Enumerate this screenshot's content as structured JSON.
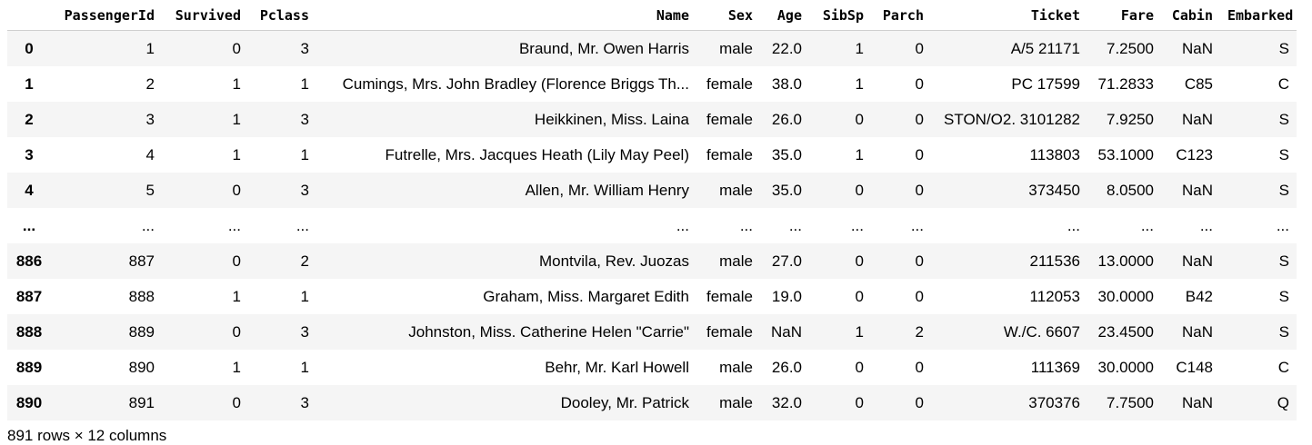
{
  "table": {
    "index_header": "",
    "columns": [
      "PassengerId",
      "Survived",
      "Pclass",
      "Name",
      "Sex",
      "Age",
      "SibSp",
      "Parch",
      "Ticket",
      "Fare",
      "Cabin",
      "Embarked"
    ],
    "rows": [
      {
        "index": "0",
        "cells": [
          "1",
          "0",
          "3",
          "Braund, Mr. Owen Harris",
          "male",
          "22.0",
          "1",
          "0",
          "A/5 21171",
          "7.2500",
          "NaN",
          "S"
        ]
      },
      {
        "index": "1",
        "cells": [
          "2",
          "1",
          "1",
          "Cumings, Mrs. John Bradley (Florence Briggs Th...",
          "female",
          "38.0",
          "1",
          "0",
          "PC 17599",
          "71.2833",
          "C85",
          "C"
        ]
      },
      {
        "index": "2",
        "cells": [
          "3",
          "1",
          "3",
          "Heikkinen, Miss. Laina",
          "female",
          "26.0",
          "0",
          "0",
          "STON/O2. 3101282",
          "7.9250",
          "NaN",
          "S"
        ]
      },
      {
        "index": "3",
        "cells": [
          "4",
          "1",
          "1",
          "Futrelle, Mrs. Jacques Heath (Lily May Peel)",
          "female",
          "35.0",
          "1",
          "0",
          "113803",
          "53.1000",
          "C123",
          "S"
        ]
      },
      {
        "index": "4",
        "cells": [
          "5",
          "0",
          "3",
          "Allen, Mr. William Henry",
          "male",
          "35.0",
          "0",
          "0",
          "373450",
          "8.0500",
          "NaN",
          "S"
        ]
      },
      {
        "index": "...",
        "cells": [
          "...",
          "...",
          "...",
          "...",
          "...",
          "...",
          "...",
          "...",
          "...",
          "...",
          "...",
          "..."
        ]
      },
      {
        "index": "886",
        "cells": [
          "887",
          "0",
          "2",
          "Montvila, Rev. Juozas",
          "male",
          "27.0",
          "0",
          "0",
          "211536",
          "13.0000",
          "NaN",
          "S"
        ]
      },
      {
        "index": "887",
        "cells": [
          "888",
          "1",
          "1",
          "Graham, Miss. Margaret Edith",
          "female",
          "19.0",
          "0",
          "0",
          "112053",
          "30.0000",
          "B42",
          "S"
        ]
      },
      {
        "index": "888",
        "cells": [
          "889",
          "0",
          "3",
          "Johnston, Miss. Catherine Helen \"Carrie\"",
          "female",
          "NaN",
          "1",
          "2",
          "W./C. 6607",
          "23.4500",
          "NaN",
          "S"
        ]
      },
      {
        "index": "889",
        "cells": [
          "890",
          "1",
          "1",
          "Behr, Mr. Karl Howell",
          "male",
          "26.0",
          "0",
          "0",
          "111369",
          "30.0000",
          "C148",
          "C"
        ]
      },
      {
        "index": "890",
        "cells": [
          "891",
          "0",
          "3",
          "Dooley, Mr. Patrick",
          "male",
          "32.0",
          "0",
          "0",
          "370376",
          "7.7500",
          "NaN",
          "Q"
        ]
      }
    ]
  },
  "footer": "891 rows × 12 columns"
}
